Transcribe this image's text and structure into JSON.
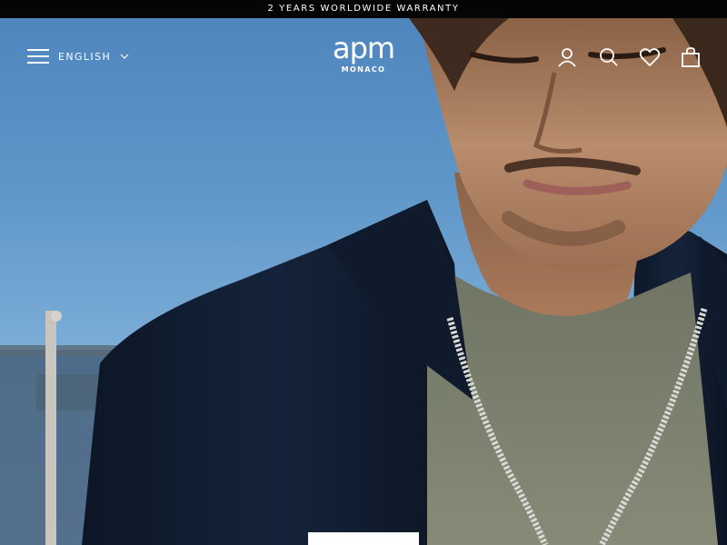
{
  "announcement": {
    "text": "2 YEARS WORLDWIDE WARRANTY"
  },
  "header": {
    "language": "ENGLISH",
    "logo_main": "apm",
    "logo_sub": "MONACO",
    "icons": [
      "menu-icon",
      "chevron-down-icon",
      "account-icon",
      "search-icon",
      "heart-icon",
      "cart-icon"
    ]
  },
  "hero": {
    "description_colors": {
      "sky": "#6a9fcf",
      "jacket": "#101c2e",
      "tshirt": "#7b7e6c",
      "skin": "#b58a6c"
    }
  }
}
